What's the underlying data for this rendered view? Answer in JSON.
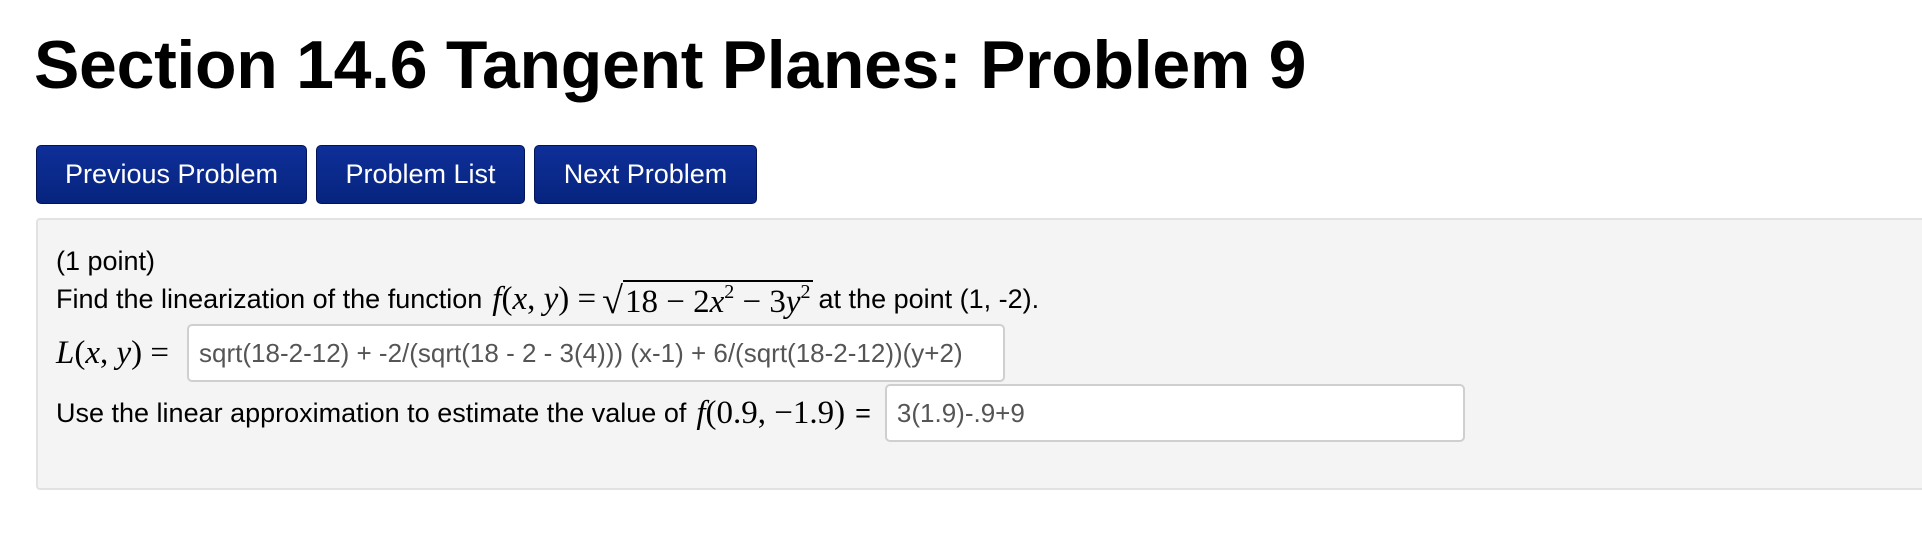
{
  "page_title": "Section 14.6 Tangent Planes: Problem 9",
  "nav": {
    "previous": "Previous Problem",
    "list": "Problem List",
    "next": "Next Problem"
  },
  "problem": {
    "points": "(1 point)",
    "prompt_prefix": "Find the linearization of the function",
    "function_lhs": "f(x, y) =",
    "function_radicand": "18 − 2x² − 3y²",
    "prompt_suffix": "at the point (1, -2).",
    "linearization_label": "L(x, y) =",
    "linearization_value": "sqrt(18-2-12) + -2/(sqrt(18 - 2 - 3(4))) (x-1) + 6/(sqrt(18-2-12))(y+2)",
    "estimate_prefix": "Use the linear approximation to estimate the value of",
    "estimate_expr": "f(0.9, −1.9)",
    "estimate_equals": "=",
    "estimate_value": "3(1.9)-.9+9"
  }
}
